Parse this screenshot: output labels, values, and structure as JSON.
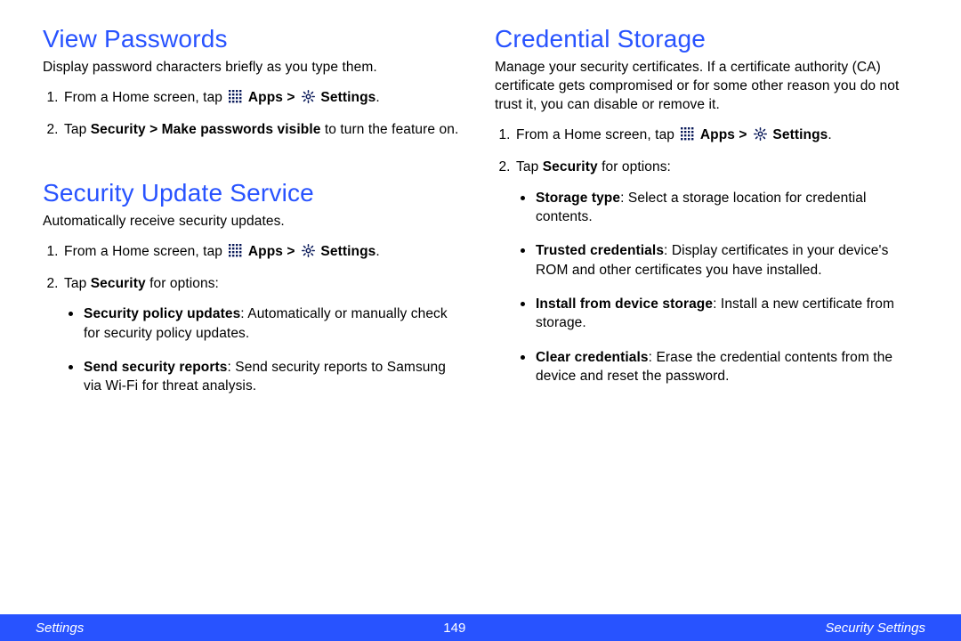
{
  "left": {
    "view_passwords": {
      "heading": "View Passwords",
      "intro": "Display password characters briefly as you type them.",
      "steps": {
        "s1_prefix": "From a Home screen, tap ",
        "s1_apps": "Apps > ",
        "s1_settings": "Settings",
        "s1_suffix": ".",
        "s2_prefix": "Tap ",
        "s2_bold": "Security > Make passwords visible",
        "s2_suffix": " to turn the feature on."
      }
    },
    "security_update": {
      "heading": "Security Update Service",
      "intro": "Automatically receive security updates.",
      "steps": {
        "s1_prefix": "From a Home screen, tap ",
        "s1_apps": "Apps > ",
        "s1_settings": "Settings",
        "s1_suffix": ".",
        "s2_prefix": "Tap ",
        "s2_bold": "Security",
        "s2_suffix": " for options:"
      },
      "bullets": {
        "b1_bold": "Security policy updates",
        "b1_text": ": Automatically or manually check for security policy updates.",
        "b2_bold": "Send security reports",
        "b2_text": ": Send security reports to Samsung via Wi-Fi for threat analysis."
      }
    }
  },
  "right": {
    "credential_storage": {
      "heading": "Credential Storage",
      "intro": "Manage your security certificates. If a certificate authority (CA) certificate gets compromised or for some other reason you do not trust it, you can disable or remove it.",
      "steps": {
        "s1_prefix": "From a Home screen, tap ",
        "s1_apps": "Apps > ",
        "s1_settings": "Settings",
        "s1_suffix": ".",
        "s2_prefix": "Tap ",
        "s2_bold": "Security",
        "s2_suffix": " for options:"
      },
      "bullets": {
        "b1_bold": "Storage type",
        "b1_text": ": Select a storage location for credential contents.",
        "b2_bold": "Trusted credentials",
        "b2_text": ": Display certificates in your device's ROM and other certificates you have installed.",
        "b3_bold": "Install from device storage",
        "b3_text": ": Install a new certificate from storage.",
        "b4_bold": "Clear credentials",
        "b4_text": ": Erase the credential contents from the device and reset the password."
      }
    }
  },
  "footer": {
    "left": "Settings",
    "center": "149",
    "right": "Security Settings"
  }
}
